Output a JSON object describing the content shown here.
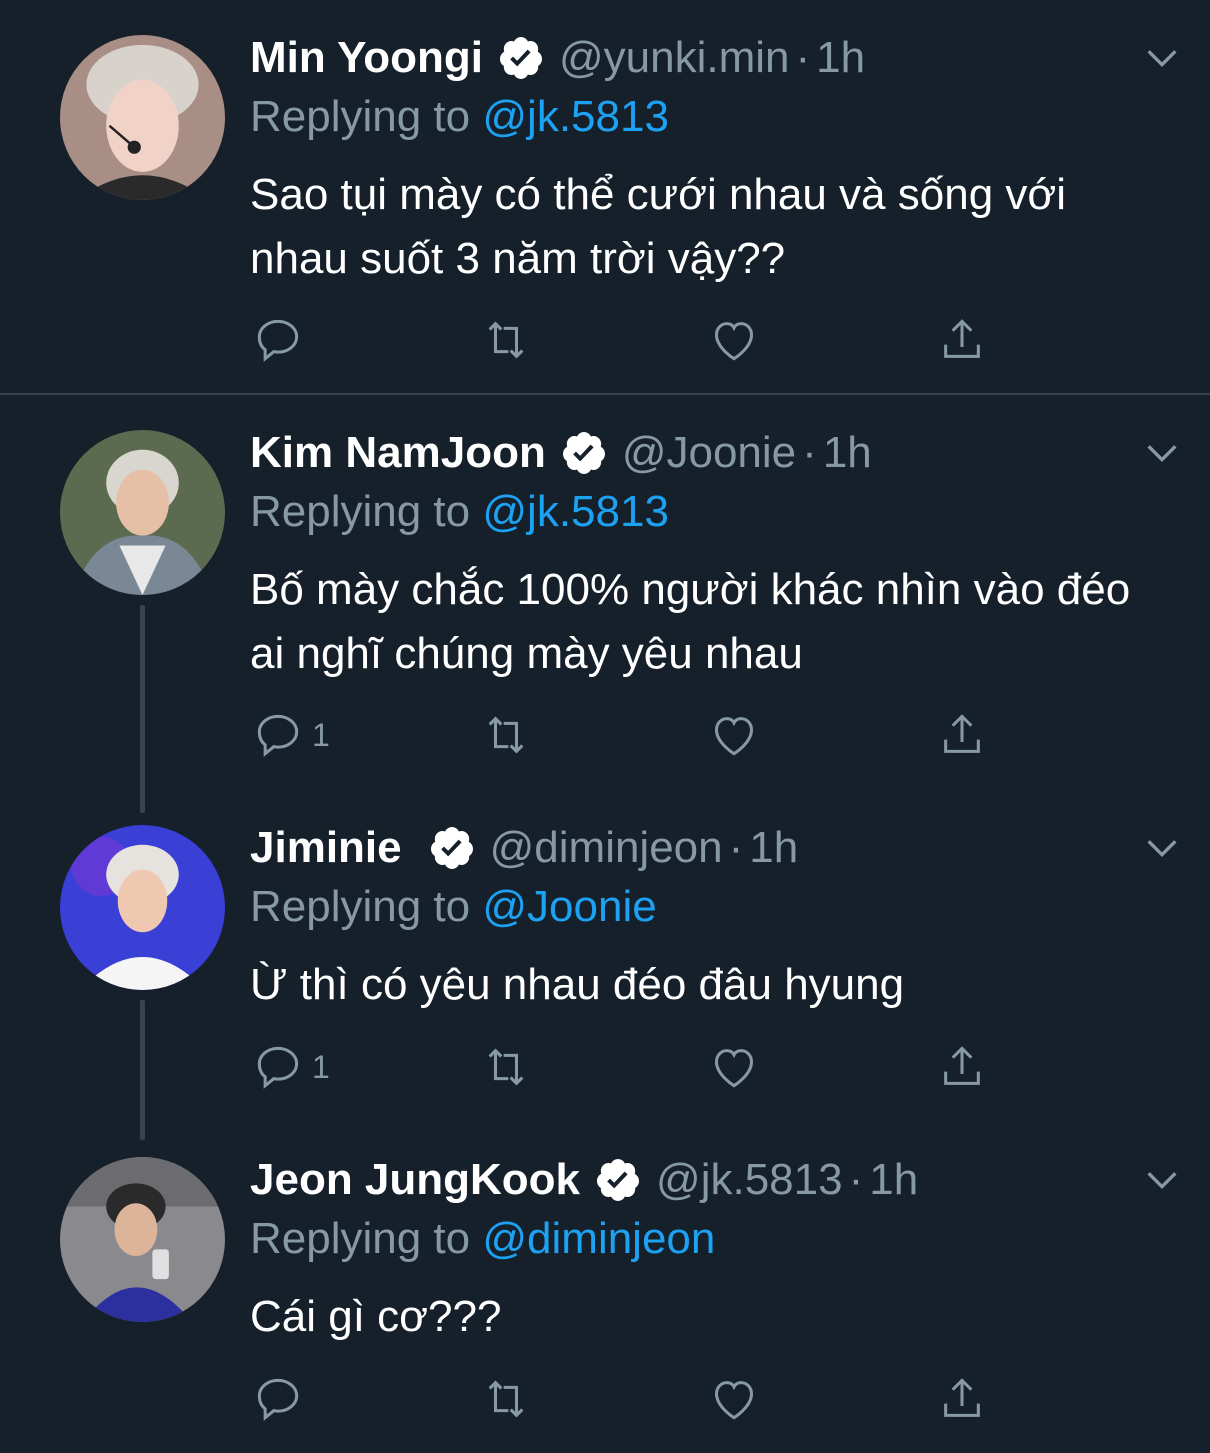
{
  "colors": {
    "background": "#15202b",
    "secondary_text": "#8899a6",
    "mention": "#1da1f2",
    "divider": "#38444d"
  },
  "tweets": [
    {
      "name": "Min Yoongi",
      "handle": "@yunki.min",
      "time": "1h",
      "replying_prefix": "Replying to",
      "replying_to": "@jk.5813",
      "text": "Sao tụi mày có thể cưới nhau và sống với nhau suốt 3 năm trời vậy??",
      "reply_count": ""
    },
    {
      "name": "Kim NamJoon",
      "handle": "@Joonie",
      "time": "1h",
      "replying_prefix": "Replying to",
      "replying_to": "@jk.5813",
      "text": "Bố mày chắc 100% người khác nhìn vào đéo ai nghĩ chúng mày yêu nhau",
      "reply_count": "1"
    },
    {
      "name": "Jiminie",
      "handle": "@diminjeon",
      "time": "1h",
      "replying_prefix": "Replying to",
      "replying_to": "@Joonie",
      "text": "Ừ thì có yêu nhau đéo đâu hyung",
      "reply_count": "1"
    },
    {
      "name": "Jeon JungKook",
      "handle": "@jk.5813",
      "time": "1h",
      "replying_prefix": "Replying to",
      "replying_to": "@diminjeon",
      "text": "Cái gì cơ???",
      "reply_count": ""
    }
  ],
  "icons": {
    "verified": "verified-badge-icon",
    "caret": "chevron-down-icon",
    "reply": "reply-icon",
    "retweet": "retweet-icon",
    "like": "heart-icon",
    "share": "share-icon"
  }
}
